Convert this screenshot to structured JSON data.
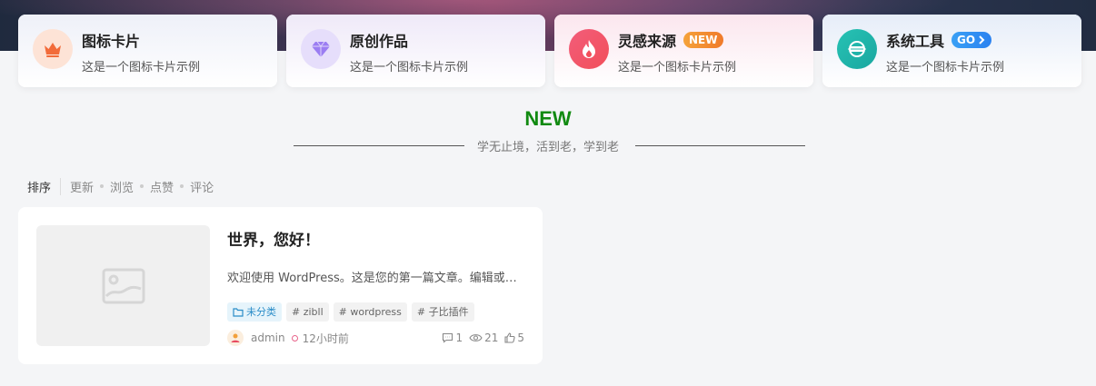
{
  "feature_cards": [
    {
      "title": "图标卡片",
      "desc": "这是一个图标卡片示例",
      "icon": "crown-icon",
      "badge": "",
      "accent": "#f26b3a"
    },
    {
      "title": "原创作品",
      "desc": "这是一个图标卡片示例",
      "icon": "diamond-icon",
      "badge": "",
      "accent": "#8c6cf0"
    },
    {
      "title": "灵感来源",
      "desc": "这是一个图标卡片示例",
      "icon": "flame-icon",
      "badge": "NEW",
      "accent": "#f2476e"
    },
    {
      "title": "系统工具",
      "desc": "这是一个图标卡片示例",
      "icon": "globe-icon",
      "badge": "GO",
      "accent": "#1fb5a8"
    }
  ],
  "section": {
    "title": "NEW",
    "subtitle": "学无止境，活到老，学到老",
    "title_color": "#118a11"
  },
  "sort": {
    "label": "排序",
    "options": [
      "更新",
      "浏览",
      "点赞",
      "评论"
    ]
  },
  "post": {
    "title": "世界，您好！",
    "excerpt": "欢迎使用 WordPress。这是您的第一篇文章。编辑或删除它，然后开始写作吧！",
    "category": "未分类",
    "tags": [
      "# zibll",
      "# wordpress",
      "# 子比插件"
    ],
    "author": "admin",
    "time": "12小时前",
    "comments": "1",
    "views": "21",
    "likes": "5"
  }
}
